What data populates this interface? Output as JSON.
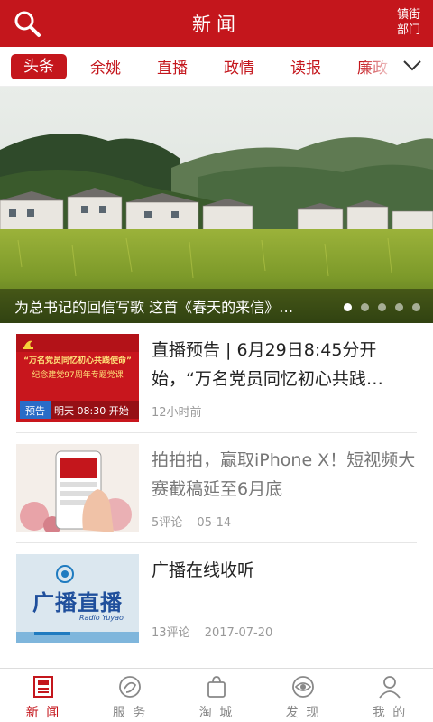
{
  "header": {
    "title": "新闻",
    "right_label": "镇街部门",
    "search_icon": "search-icon"
  },
  "tabs": [
    {
      "label": "头条",
      "active": true
    },
    {
      "label": "余姚"
    },
    {
      "label": "直播"
    },
    {
      "label": "政情"
    },
    {
      "label": "读报"
    },
    {
      "label": "廉政"
    }
  ],
  "banner": {
    "caption": "为总书记的回信写歌 这首《春天的来信》…",
    "slides": 5,
    "current_slide": 1
  },
  "news": [
    {
      "headline": "直播预告 | 6月29日8:45分开始，“万名党员同忆初心共践…",
      "meta": [
        "12小时前"
      ],
      "read": false,
      "thumb": {
        "line1": "“万名党员同忆初心共践使命”",
        "line2": "纪念建党97周年专题党课",
        "badge": "预告",
        "time": "明天 08:30 开始"
      }
    },
    {
      "headline": "拍拍拍，赢取iPhone X！短视频大赛截稿延至6月底",
      "meta": [
        "5评论",
        "05-14"
      ],
      "read": true
    },
    {
      "headline": "广播在线收听",
      "meta": [
        "13评论",
        "2017-07-20"
      ],
      "read": false,
      "thumb": {
        "logo_text": "广播直播",
        "sub_text": "Radio Yuyao"
      }
    }
  ],
  "tabbar": [
    {
      "label": "新 闻",
      "icon": "newspaper-icon",
      "active": true
    },
    {
      "label": "服 务",
      "icon": "service-icon"
    },
    {
      "label": "淘 城",
      "icon": "shopping-bag-icon"
    },
    {
      "label": "发 现",
      "icon": "discover-eye-icon"
    },
    {
      "label": "我 的",
      "icon": "user-icon"
    }
  ],
  "colors": {
    "brand": "#c4161c",
    "text": "#222222",
    "meta": "#999999"
  }
}
